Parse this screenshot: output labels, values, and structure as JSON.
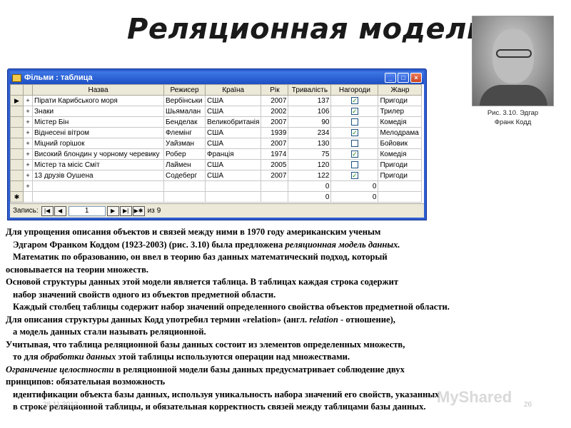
{
  "slide": {
    "title": "Реляционная модель",
    "date": "28.11.2012",
    "page_number": "26",
    "watermark": "MyShared"
  },
  "window": {
    "title": "Фільми : таблица",
    "minimize_glyph": "_",
    "maximize_glyph": "□",
    "close_glyph": "×"
  },
  "table": {
    "columns": [
      "",
      "",
      "Назва",
      "Режисер",
      "Країна",
      "Рік",
      "Тривалість",
      "Нагороди",
      "Жанр"
    ],
    "rows": [
      {
        "sel": "▶",
        "exp": "+",
        "title": "Пірати Карибського моря",
        "director": "Вербінськи",
        "country": "США",
        "year": "2007",
        "duration": "137",
        "award": true,
        "genre": "Пригоди"
      },
      {
        "sel": "",
        "exp": "+",
        "title": "Знаки",
        "director": "Шьямалан",
        "country": "США",
        "year": "2002",
        "duration": "106",
        "award": true,
        "genre": "Трилер"
      },
      {
        "sel": "",
        "exp": "+",
        "title": "Містер Бін",
        "director": "Бенделак",
        "country": "Великобританія",
        "year": "2007",
        "duration": "90",
        "award": false,
        "genre": "Комедія"
      },
      {
        "sel": "",
        "exp": "+",
        "title": "Віднесені вітром",
        "director": "Флемінг",
        "country": "США",
        "year": "1939",
        "duration": "234",
        "award": true,
        "genre": "Мелодрама"
      },
      {
        "sel": "",
        "exp": "+",
        "title": "Міцний горішок",
        "director": "Уайзман",
        "country": "США",
        "year": "2007",
        "duration": "130",
        "award": false,
        "genre": "Бойовик"
      },
      {
        "sel": "",
        "exp": "+",
        "title": "Високий блондин у чорному черевику",
        "director": "Робер",
        "country": "Франція",
        "year": "1974",
        "duration": "75",
        "award": true,
        "genre": "Комедія"
      },
      {
        "sel": "",
        "exp": "+",
        "title": "Містер та місіс Сміт",
        "director": "Лаймен",
        "country": "США",
        "year": "2005",
        "duration": "120",
        "award": false,
        "genre": "Пригоди"
      },
      {
        "sel": "",
        "exp": "+",
        "title": "13 друзів Оушена",
        "director": "Содеберг",
        "country": "США",
        "year": "2007",
        "duration": "122",
        "award": true,
        "genre": "Пригоди"
      },
      {
        "sel": "",
        "exp": "+",
        "title": "",
        "director": "",
        "country": "",
        "year": "",
        "duration": "0",
        "award_zero": "0",
        "award": null,
        "genre": ""
      },
      {
        "sel": "✱",
        "exp": "",
        "title": "",
        "director": "",
        "country": "",
        "year": "",
        "duration": "0",
        "award_zero": "0",
        "award": null,
        "genre": ""
      }
    ]
  },
  "navbar": {
    "label": "Запись:",
    "record": "1",
    "of_label": "из",
    "total": "9",
    "first_glyph": "|◀",
    "prev_glyph": "◀",
    "next_glyph": "▶",
    "last_glyph": "▶|",
    "new_glyph": "▶✱"
  },
  "photo": {
    "caption_line1": "Рис. 3.10. Эдгар",
    "caption_line2": "Франк Кодд"
  },
  "text": {
    "l1": "Для упрощения описания объектов и связей между ними в 1970 году американским ученым",
    "l2a": "Эдгаром Франком Коддом (1923-2003) (рис. 3.10) была предложена ",
    "l2b": "реляционная модель данных.",
    "l3": "Математик по образованию, он ввел в теорию баз данных математический подход, который",
    "l4": "основывается на теории множеств.",
    "l5": "Основой структуры данных этой модели является таблица. В таблицах каждая строка содержит",
    "l6": "набор значений свойств одного из объектов предметной области.",
    "l7": "Каждый столбец таблицы содержит набор значений определенного свойства объектов предметной области.",
    "l8a": "Для описания структуры данных Кодд употребил термин «relation» (англ. ",
    "l8b": "relation",
    "l8c": " - отношение),",
    "l9": "а модель данных стали называть реляционной.",
    "l10": "Учитывая, что таблица реляционной базы данных состоит из элементов определенных множеств,",
    "l11a": "то для ",
    "l11b": "обработки данных",
    "l11c": " этой таблицы используются операции над множествами.",
    "l12a": "Ограничение целостности",
    "l12b": " в реляционной модели базы данных предусматривает соблюдение двух",
    "l13": "принципов: обязательная возможность",
    "l14": "идентификации объекта базы данных, используя уникальность набора значений его свойств, указанных",
    "l15": "в строке реляционной таблицы, и обязательная корректность связей между таблицами базы данных."
  }
}
